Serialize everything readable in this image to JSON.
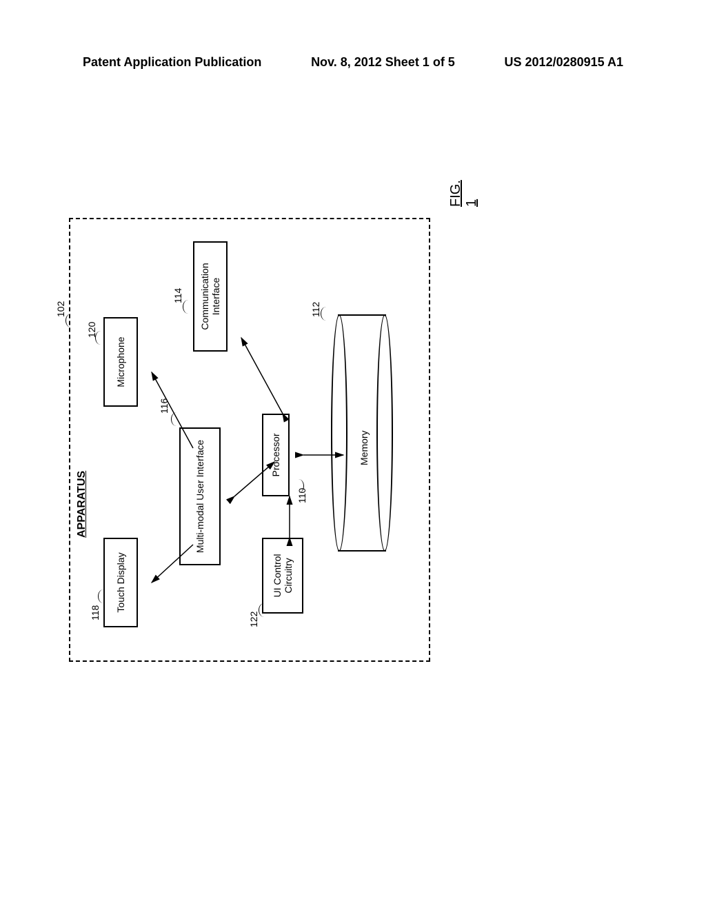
{
  "header": {
    "left": "Patent Application Publication",
    "center": "Nov. 8, 2012  Sheet 1 of 5",
    "right": "US 2012/0280915 A1"
  },
  "diagram": {
    "apparatus_title": "APPARATUS",
    "boxes": {
      "touch_display": "Touch Display",
      "microphone": "Microphone",
      "multimodal": "Multi-modal User Interface",
      "comm_interface": "Communication Interface",
      "ui_control": "UI Control Circuitry",
      "processor": "Processor",
      "memory": "Memory"
    },
    "refs": {
      "r102": "102",
      "r118": "118",
      "r120": "120",
      "r116": "116",
      "r114": "114",
      "r122": "122",
      "r110": "110",
      "r112": "112"
    },
    "figure_label": "FIG. 1"
  }
}
